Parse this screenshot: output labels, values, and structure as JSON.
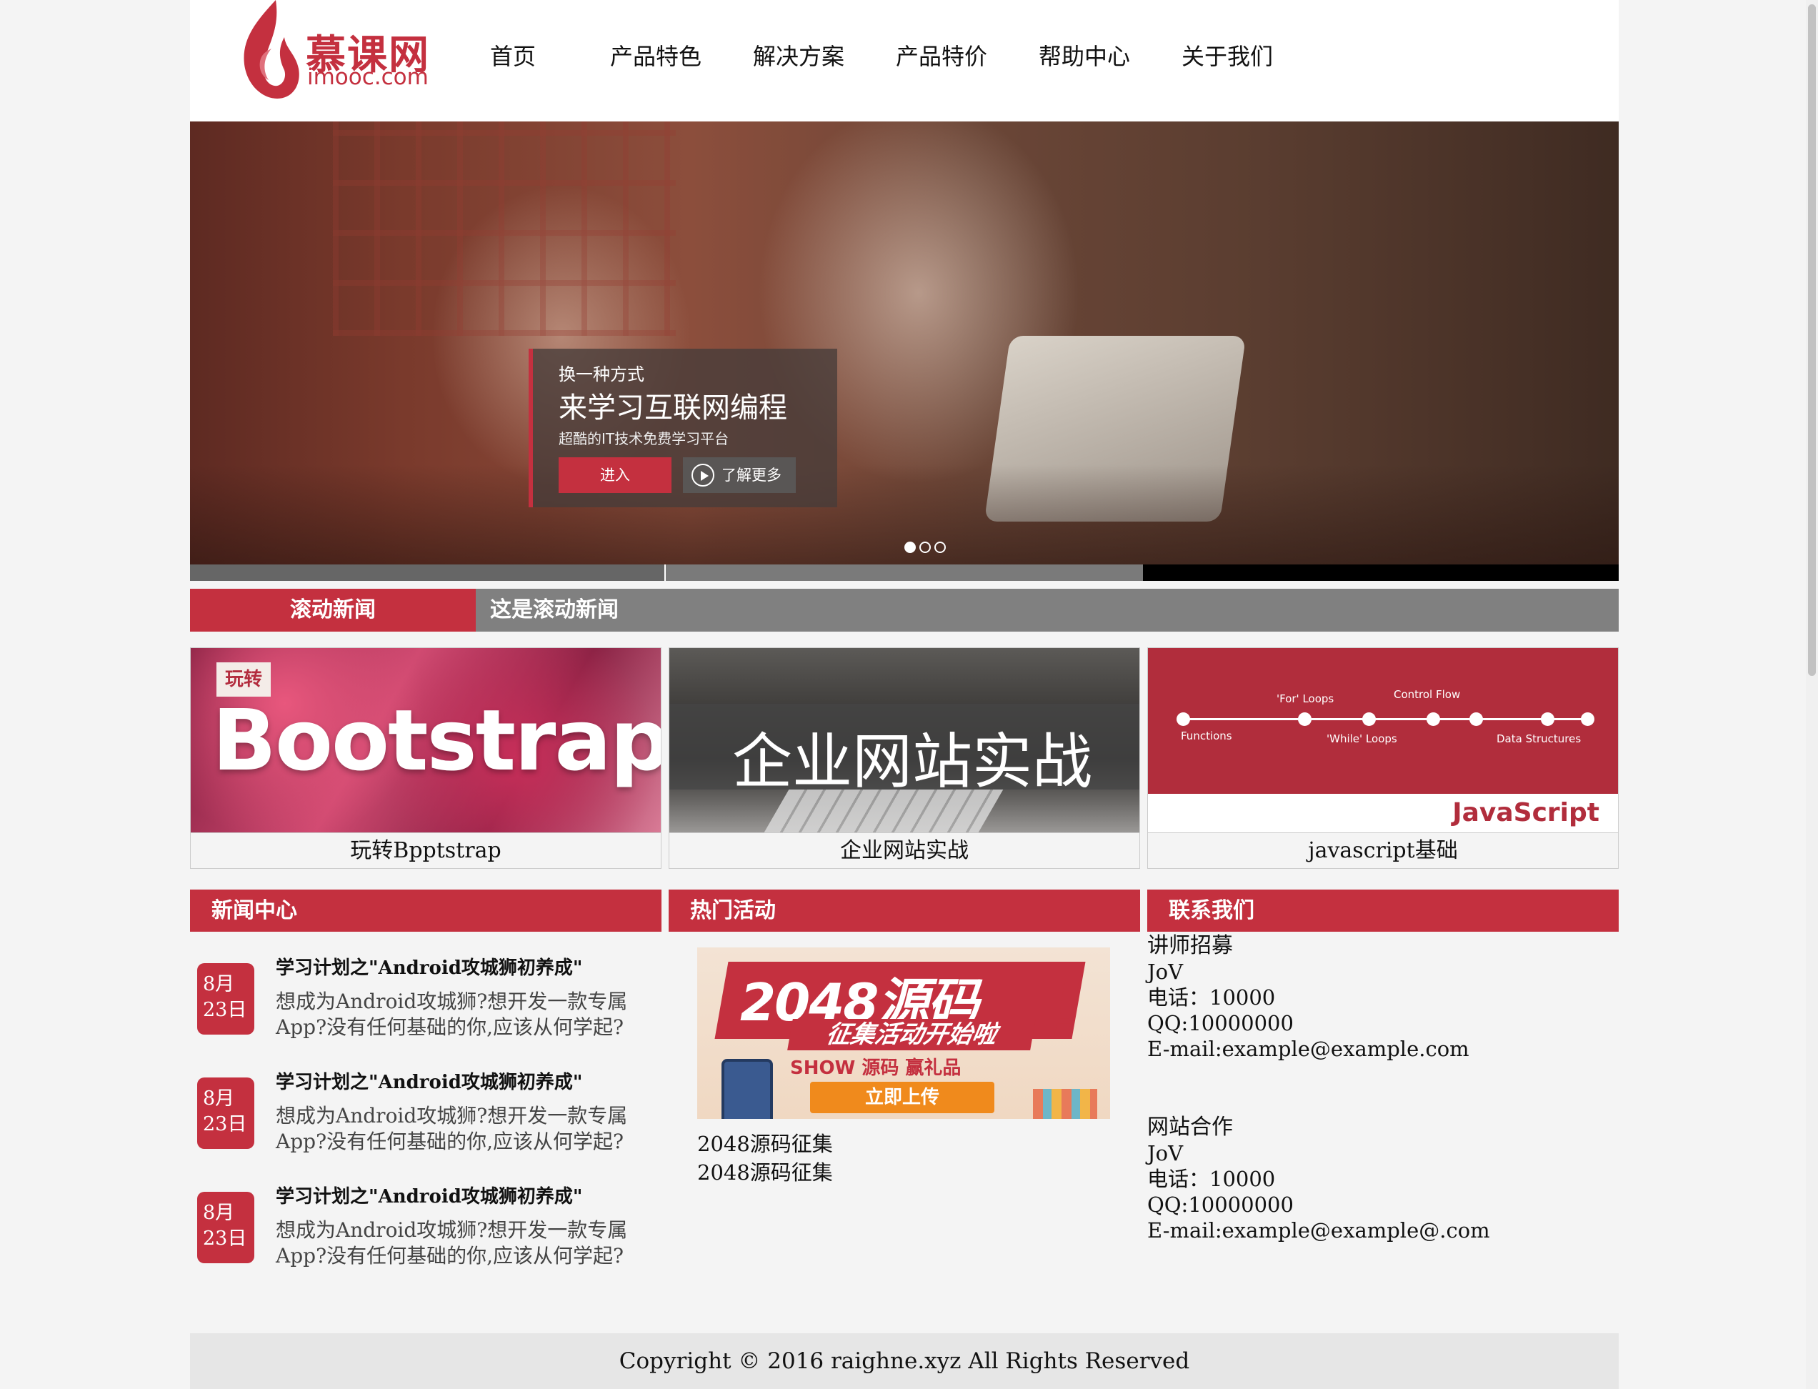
{
  "header": {
    "logo_cn": "慕课网",
    "logo_en": "imooc.com",
    "nav": [
      "首页",
      "产品特色",
      "解决方案",
      "产品特价",
      "帮助中心",
      "关于我们"
    ]
  },
  "banner": {
    "line1": "换一种方式",
    "line2": "来学习互联网编程",
    "line3": "超酷的IT技术免费学习平台",
    "enter_label": "进入",
    "more_label": "了解更多",
    "slides": 3,
    "active_slide": 1
  },
  "ticker": {
    "label": "滚动新闻",
    "text": "这是滚动新闻"
  },
  "courses": [
    {
      "caption": "玩转Bpptstrap",
      "image_tag": "玩转",
      "image_title": "Bootstrap"
    },
    {
      "caption": "企业网站实战",
      "image_title": "企业网站实战"
    },
    {
      "caption": "javascript基础",
      "image_title": "JavaScript",
      "image_labels": [
        "'For' Loops",
        "Control Flow",
        "Functions",
        "'While' Loops",
        "Data Structures"
      ]
    }
  ],
  "sections": {
    "news_title": "新闻中心",
    "activity_title": "热门活动",
    "contact_title": "联系我们"
  },
  "news": [
    {
      "month": "8月",
      "day": "23日",
      "title": "学习计划之\"Android攻城狮初养成\"",
      "desc": "想成为Android攻城狮?想开发一款专属App?没有任何基础的你,应该从何学起?"
    },
    {
      "month": "8月",
      "day": "23日",
      "title": "学习计划之\"Android攻城狮初养成\"",
      "desc": "想成为Android攻城狮?想开发一款专属App?没有任何基础的你,应该从何学起?"
    },
    {
      "month": "8月",
      "day": "23日",
      "title": "学习计划之\"Android攻城狮初养成\"",
      "desc": "想成为Android攻城狮?想开发一款专属App?没有任何基础的你,应该从何学起?"
    }
  ],
  "activity": {
    "image_title": "2048源码",
    "image_subtitle": "征集活动开始啦",
    "image_show": "SHOW 源码 赢礼品",
    "image_button": "立即上传",
    "links": [
      "2048源码征集",
      "2048源码征集"
    ]
  },
  "contacts": [
    {
      "title": "讲师招募",
      "name": "JoV",
      "phone": "电话：10000",
      "qq": "QQ:10000000",
      "email": "E-mail:example@example.com"
    },
    {
      "title": "网站合作",
      "name": "JoV",
      "phone": "电话：10000",
      "qq": "QQ:10000000",
      "email": "E-mail:example@example@.com"
    }
  ],
  "footer": {
    "copyright": "Copyright © 2016 raighne.xyz All Rights Reserved"
  },
  "colors": {
    "brand_red": "#c4303f",
    "ticker_gray": "#808080",
    "page_bg": "#f4f4f4"
  }
}
